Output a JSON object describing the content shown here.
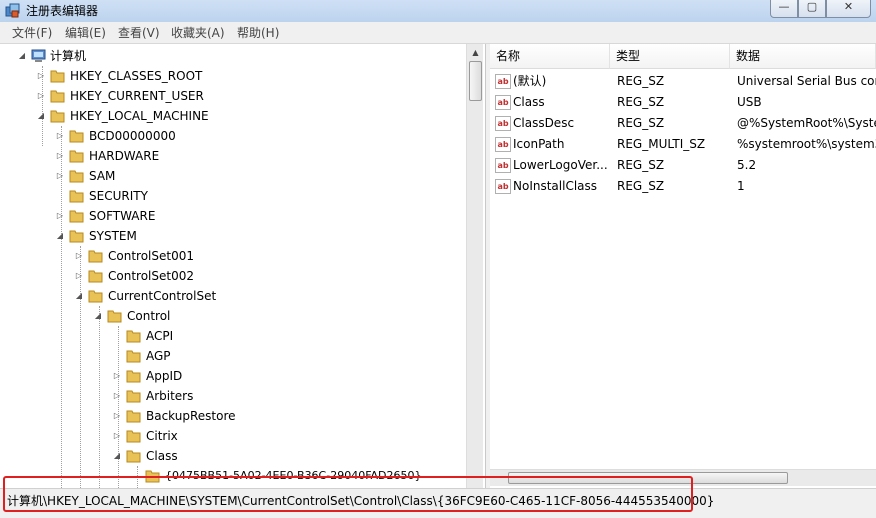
{
  "window": {
    "title": "注册表编辑器",
    "minimize_glyph": "—",
    "maximize_glyph": "▢",
    "close_glyph": "✕"
  },
  "menu": [
    "文件(F)",
    "编辑(E)",
    "查看(V)",
    "收藏夹(A)",
    "帮助(H)"
  ],
  "tree": {
    "root": "计算机",
    "hkcr": "HKEY_CLASSES_ROOT",
    "hkcu": "HKEY_CURRENT_USER",
    "hklm": "HKEY_LOCAL_MACHINE",
    "bcd": "BCD00000000",
    "hardware": "HARDWARE",
    "sam": "SAM",
    "security": "SECURITY",
    "software": "SOFTWARE",
    "system": "SYSTEM",
    "cs001": "ControlSet001",
    "cs002": "ControlSet002",
    "ccs": "CurrentControlSet",
    "control": "Control",
    "acpi": "ACPI",
    "agp": "AGP",
    "appid": "AppID",
    "arbiters": "Arbiters",
    "backuprestore": "BackupRestore",
    "citrix": "Citrix",
    "class": "Class",
    "class_child": "{0475BB51-5A02-4EE0-B36C-29040FAD2650}"
  },
  "columns": {
    "name": "名称",
    "type": "类型",
    "data": "数据"
  },
  "values": [
    {
      "name": "(默认)",
      "type": "REG_SZ",
      "data": "Universal Serial Bus cor"
    },
    {
      "name": "Class",
      "type": "REG_SZ",
      "data": "USB"
    },
    {
      "name": "ClassDesc",
      "type": "REG_SZ",
      "data": "@%SystemRoot%\\Syste"
    },
    {
      "name": "IconPath",
      "type": "REG_MULTI_SZ",
      "data": "%systemroot%\\system3"
    },
    {
      "name": "LowerLogoVer...",
      "type": "REG_SZ",
      "data": "5.2"
    },
    {
      "name": "NoInstallClass",
      "type": "REG_SZ",
      "data": "1"
    }
  ],
  "status": {
    "path": "计算机\\HKEY_LOCAL_MACHINE\\SYSTEM\\CurrentControlSet\\Control\\Class\\{36FC9E60-C465-11CF-8056-444553540000}"
  },
  "icons": {
    "value_icon": "string-value-icon",
    "folder_color": "#e8c257",
    "highlight_color": "#e02020"
  }
}
